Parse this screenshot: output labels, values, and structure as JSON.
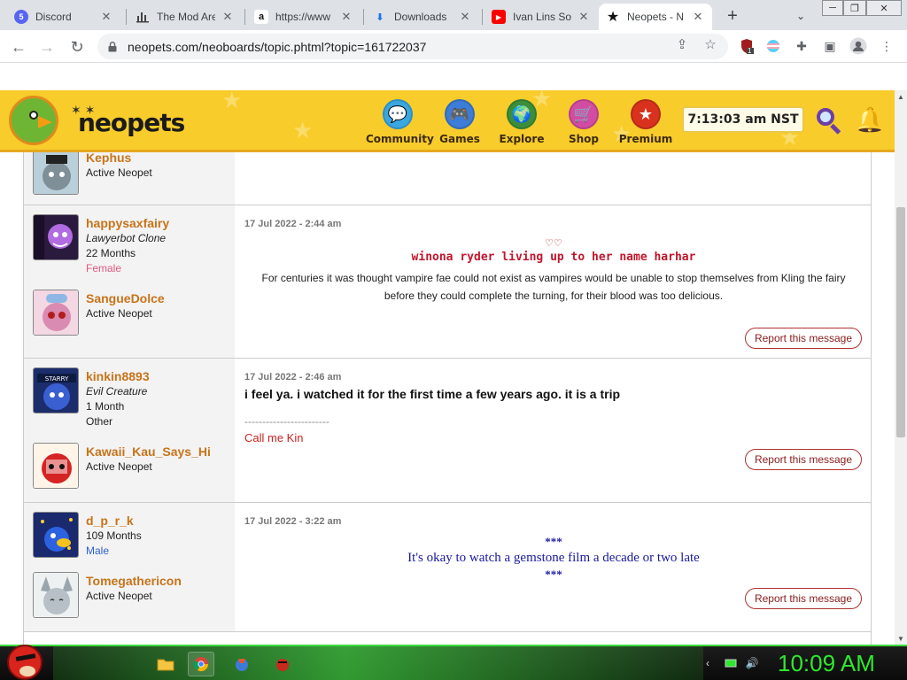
{
  "browser": {
    "tabs": [
      {
        "label": "Discord",
        "icon": "discord-icon",
        "badge": "5"
      },
      {
        "label": "The Mod Are",
        "icon": "chart-icon"
      },
      {
        "label": "https://www",
        "icon": "amazon-icon"
      },
      {
        "label": "Downloads",
        "icon": "download-icon"
      },
      {
        "label": "Ivan Lins So",
        "icon": "youtube-icon"
      },
      {
        "label": "Neopets - N",
        "icon": "star-icon",
        "active": true
      }
    ],
    "url": "neopets.com/neoboards/topic.phtml?topic=161722037",
    "extension_badge": "1"
  },
  "neopets": {
    "logo": "neopets",
    "nav": [
      {
        "label": "Community",
        "icon": "community-icon"
      },
      {
        "label": "Games",
        "icon": "games-icon"
      },
      {
        "label": "Explore",
        "icon": "explore-icon"
      },
      {
        "label": "Shop",
        "icon": "shop-icon"
      },
      {
        "label": "Premium",
        "icon": "premium-icon"
      }
    ],
    "clock": "7:13:03 am NST"
  },
  "posts": [
    {
      "partial": true,
      "pet": {
        "name": "Kephus",
        "status": "Active Neopet"
      }
    },
    {
      "date": "17 Jul 2022 - 2:44 am",
      "user": {
        "name": "happysaxfairy",
        "title": "Lawyerbot Clone",
        "age": "22 Months",
        "gender": "Female"
      },
      "pet": {
        "name": "SangueDolce",
        "status": "Active Neopet"
      },
      "hearts": "♡♡",
      "headline": "winona ryder living up to her name harhar",
      "body": "For centuries it was thought vampire fae could not exist as vampires would be unable to stop themselves from Kling the fairy before they could complete the turning, for their blood was too delicious.",
      "report": "Report this message"
    },
    {
      "date": "17 Jul 2022 - 2:46 am",
      "user": {
        "name": "kinkin8893",
        "title": "Evil Creature",
        "age": "1 Month",
        "gender": "Other"
      },
      "pet": {
        "name": "Kawaii_Kau_Says_Hi",
        "status": "Active Neopet"
      },
      "body": "i feel ya. i watched it for the first time a few years ago. it is a trip",
      "divider": "------------------------",
      "signature": "Call me Kin",
      "report": "Report this message"
    },
    {
      "date": "17 Jul 2022 - 3:22 am",
      "user": {
        "name": "d_p_r_k",
        "age": "109 Months",
        "gender": "Male"
      },
      "pet": {
        "name": "Tomegathericon",
        "status": "Active Neopet"
      },
      "stars_top": "***",
      "body": "It's okay to watch a gemstone film a decade or two late",
      "stars_bottom": "***",
      "report": "Report this message"
    }
  ],
  "taskbar": {
    "clock": "10:09 AM",
    "apps": [
      "folder-icon",
      "chrome-icon",
      "game-icon",
      "bird-icon"
    ]
  }
}
